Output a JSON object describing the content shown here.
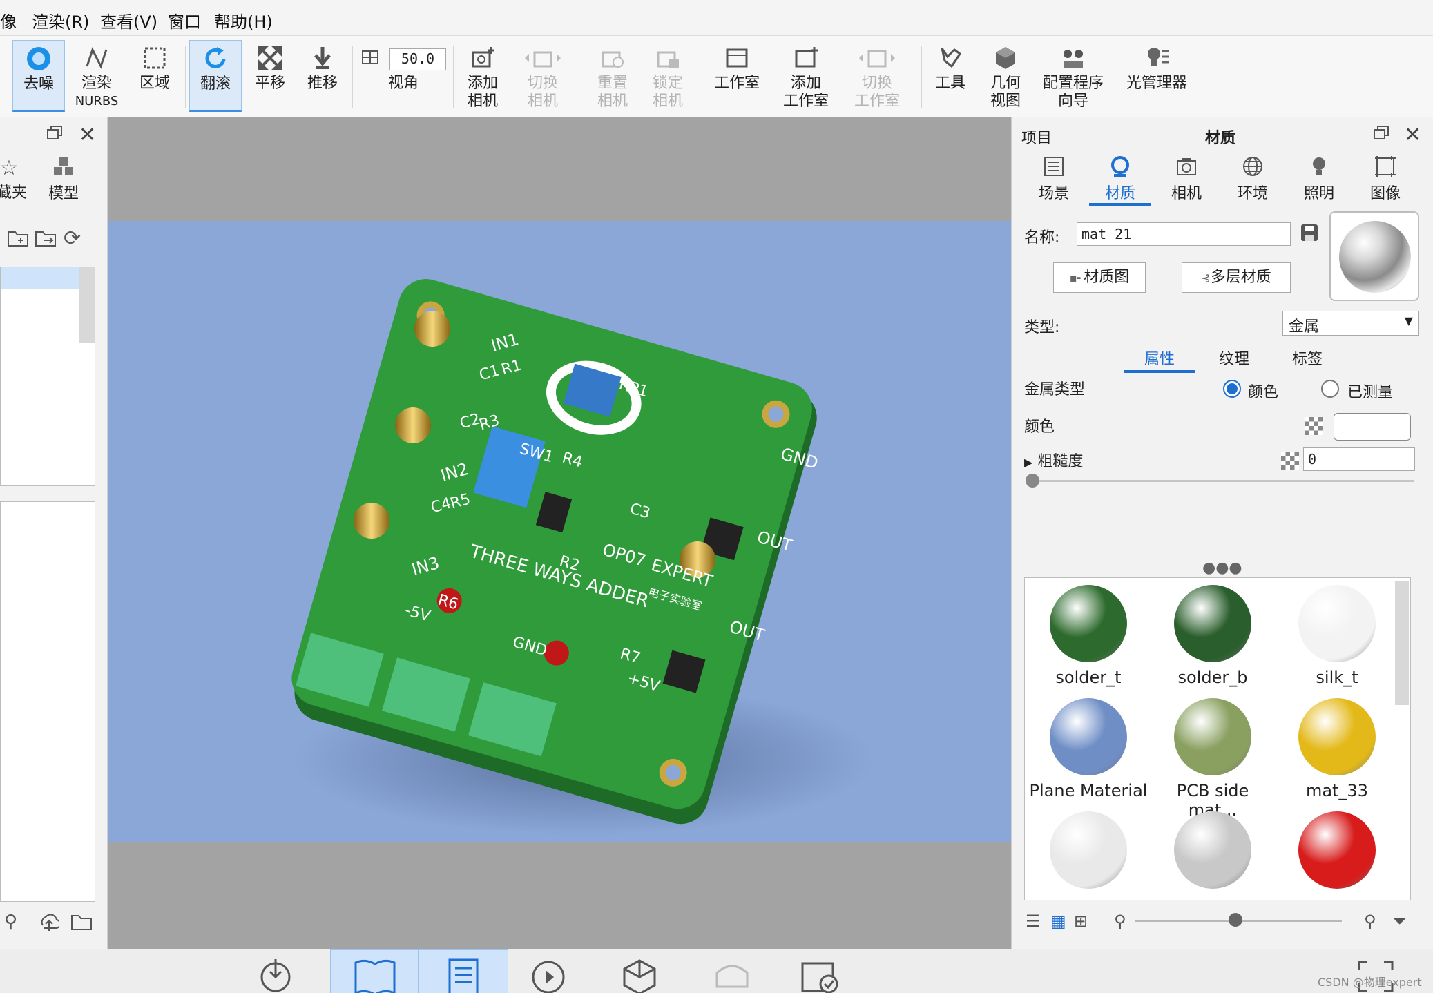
{
  "menubar": {
    "items": [
      "像",
      "渲染(R)",
      "查看(V)",
      "窗口",
      "帮助(H)"
    ]
  },
  "toolbar": {
    "buttons": [
      {
        "name": "denoise",
        "label": "去噪",
        "active": true
      },
      {
        "name": "render-nurbs",
        "label": "渲染",
        "label2": "NURBS"
      },
      {
        "name": "region",
        "label": "区域"
      },
      {
        "name": "tumble",
        "label": "翻滚",
        "active": true
      },
      {
        "name": "pan",
        "label": "平移"
      },
      {
        "name": "dolly",
        "label": "推移"
      },
      {
        "name": "field-of-view",
        "label": "视角",
        "value": "50.0"
      },
      {
        "name": "add-camera",
        "label": "添加",
        "label2": "相机"
      },
      {
        "name": "switch-camera",
        "label": "切换",
        "label2": "相机",
        "disabled": true
      },
      {
        "name": "reset-camera",
        "label": "重置",
        "label2": "相机",
        "disabled": true
      },
      {
        "name": "lock-camera",
        "label": "锁定",
        "label2": "相机",
        "disabled": true
      },
      {
        "name": "studio",
        "label": "工作室"
      },
      {
        "name": "add-studio",
        "label": "添加",
        "label2": "工作室"
      },
      {
        "name": "switch-studio",
        "label": "切换",
        "label2": "工作室",
        "disabled": true
      },
      {
        "name": "tools",
        "label": "工具"
      },
      {
        "name": "geometry-view",
        "label": "几何",
        "label2": "视图"
      },
      {
        "name": "config-wizard",
        "label": "配置程序",
        "label2": "向导"
      },
      {
        "name": "light-manager",
        "label": "光管理器"
      }
    ]
  },
  "leftpanel": {
    "tabs": [
      "藏夹",
      "模型"
    ]
  },
  "rightpanel": {
    "header_left": "项目",
    "header_title": "材质",
    "tabs": [
      "场景",
      "材质",
      "相机",
      "环境",
      "照明",
      "图像"
    ],
    "name_label": "名称:",
    "name_value": "mat_21",
    "material_graph_btn": "材质图",
    "multilayer_btn": "多层材质",
    "type_label": "类型:",
    "type_value": "金属",
    "subtabs": [
      "属性",
      "纹理",
      "标签"
    ],
    "metal_type_label": "金属类型",
    "radio_color": "颜色",
    "radio_measured": "已测量",
    "color_label": "颜色",
    "roughness_label": "粗糙度",
    "roughness_value": "0",
    "swatches": [
      {
        "label": "solder_t",
        "color": "#2d6a2d"
      },
      {
        "label": "solder_b",
        "color": "#2a5e2c"
      },
      {
        "label": "silk_t",
        "color": "#f3f3f3"
      },
      {
        "label": "Plane Material",
        "color": "#6f8ec6"
      },
      {
        "label": "PCB side mat...",
        "color": "#8aa060"
      },
      {
        "label": "mat_33",
        "color": "#e3b91a"
      },
      {
        "label": "",
        "color": "#e9e9e9"
      },
      {
        "label": "",
        "color": "#c8c8c8"
      },
      {
        "label": "",
        "color": "#d81b1b"
      }
    ]
  },
  "viewport": {
    "board_labels": [
      "IN1",
      "C1",
      "R1",
      "C2",
      "R3",
      "IN2",
      "C4",
      "R5",
      "IN3",
      "SW1",
      "R4",
      "R2",
      "C3",
      "OP07",
      "GND",
      "OUT",
      "OUT",
      "THREE WAYS ADDER",
      "EXPERT",
      "-5V",
      "GND",
      "+5V",
      "R7",
      "R6",
      "RP1"
    ],
    "board_subtitle": "电子实验室"
  },
  "watermark": "CSDN @物理expert",
  "colors": {
    "accent": "#1f6fd0",
    "pcb": "#2f9b3a",
    "background_plane": "#8aa7d8"
  }
}
